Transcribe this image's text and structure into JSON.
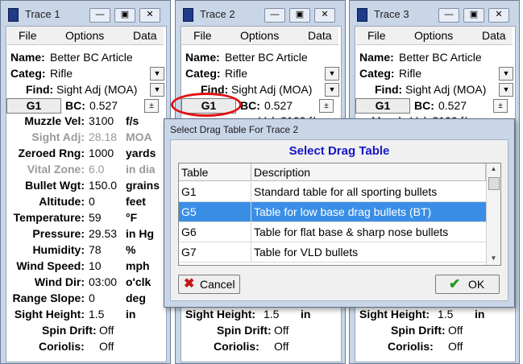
{
  "windows": [
    {
      "title": "Trace 1",
      "menu": [
        "File",
        "Options",
        "Data"
      ],
      "name_label": "Name:",
      "name_value": "Better BC Article",
      "categ_label": "Categ:",
      "categ_value": "Rifle",
      "find_label": "Find:",
      "find_value": "Sight Adj (MOA)",
      "g1_label": "G1",
      "bc_label": "BC:",
      "bc_value": "0.527",
      "rows": [
        {
          "label": "Muzzle Vel:",
          "value": "3100",
          "unit": "f/s",
          "gray": false
        },
        {
          "label": "Sight Adj:",
          "value": "28.18",
          "unit": "MOA",
          "gray": true
        },
        {
          "label": "Zeroed   Rng:",
          "value": "1000",
          "unit": "yards",
          "gray": false
        },
        {
          "label": "Vital Zone:",
          "value": "6.0",
          "unit": "in dia",
          "gray": true
        },
        {
          "label": "Bullet Wgt:",
          "value": "150.0",
          "unit": "grains",
          "gray": false
        },
        {
          "label": "Altitude:",
          "value": "0",
          "unit": "feet",
          "gray": false
        },
        {
          "label": "Temperature:",
          "value": "59",
          "unit": "°F",
          "gray": false
        },
        {
          "label": "Pressure:",
          "value": "29.53",
          "unit": "in Hg",
          "gray": false
        },
        {
          "label": "Humidity:",
          "value": "78",
          "unit": "%",
          "gray": false
        },
        {
          "label": "Wind Speed:",
          "value": "10",
          "unit": "mph",
          "gray": false
        },
        {
          "label": "Wind Dir:",
          "value": "03:00",
          "unit": "o'clk",
          "gray": false
        },
        {
          "label": "Range Slope:",
          "value": "0",
          "unit": "deg",
          "gray": false
        },
        {
          "label": "Sight Height:",
          "value": "1.5",
          "unit": "in",
          "gray": false
        }
      ],
      "spin_label": "Spin Drift:",
      "spin_value": "Off",
      "coriolis_label": "Coriolis:",
      "coriolis_value": "Off"
    },
    {
      "title": "Trace 2",
      "menu": [
        "File",
        "Options",
        "Data"
      ],
      "name_label": "Name:",
      "name_value": "Better BC Article",
      "categ_label": "Categ:",
      "categ_value": "Rifle",
      "find_label": "Find:",
      "find_value": "Sight Adj (MOA)",
      "g1_label": "G1",
      "bc_label": "BC:",
      "bc_value": "0.527",
      "partial_row": "Vel: 3100  f/s",
      "sight_label": "Sight Height:",
      "sight_value": "1.5",
      "sight_unit": "in",
      "spin_label": "Spin Drift:",
      "spin_value": "Off",
      "coriolis_label": "Coriolis:",
      "coriolis_value": "Off"
    },
    {
      "title": "Trace 3",
      "menu": [
        "File",
        "Options",
        "Data"
      ],
      "name_label": "Name:",
      "name_value": "Better BC Article",
      "categ_label": "Categ:",
      "categ_value": "Rifle",
      "find_label": "Find:",
      "find_value": "Sight Adj (MOA)",
      "g1_label": "G1",
      "bc_label": "BC:",
      "bc_value": "0.527",
      "partial_row": "Muzzle Vel: 3100  f/s",
      "sight_label": "Sight Height:",
      "sight_value": "1.5",
      "sight_unit": "in",
      "spin_label": "Spin Drift:",
      "spin_value": "Off",
      "coriolis_label": "Coriolis:",
      "coriolis_value": "Off"
    }
  ],
  "dialog": {
    "title": "Select Drag Table For Trace 2",
    "heading": "Select Drag Table",
    "col_table": "Table",
    "col_desc": "Description",
    "rows": [
      {
        "table": "G1",
        "desc": "Standard table for all sporting bullets",
        "selected": false
      },
      {
        "table": "G5",
        "desc": "Table for low base drag bullets (BT)",
        "selected": true
      },
      {
        "table": "G6",
        "desc": "Table for flat base & sharp nose bullets",
        "selected": false
      },
      {
        "table": "G7",
        "desc": "Table for VLD bullets",
        "selected": false
      }
    ],
    "cancel_label": "Cancel",
    "ok_label": "OK"
  },
  "icons": {
    "close": "close-icon",
    "minimize": "minimize-icon",
    "restore": "restore-icon",
    "dropdown": "chevron-down-icon",
    "cancel": "red-x-icon",
    "ok": "green-check-icon"
  },
  "colors": {
    "selection": "#3a8ee6",
    "dialog_heading": "#1515c8",
    "highlight_circle": "#e01010"
  }
}
